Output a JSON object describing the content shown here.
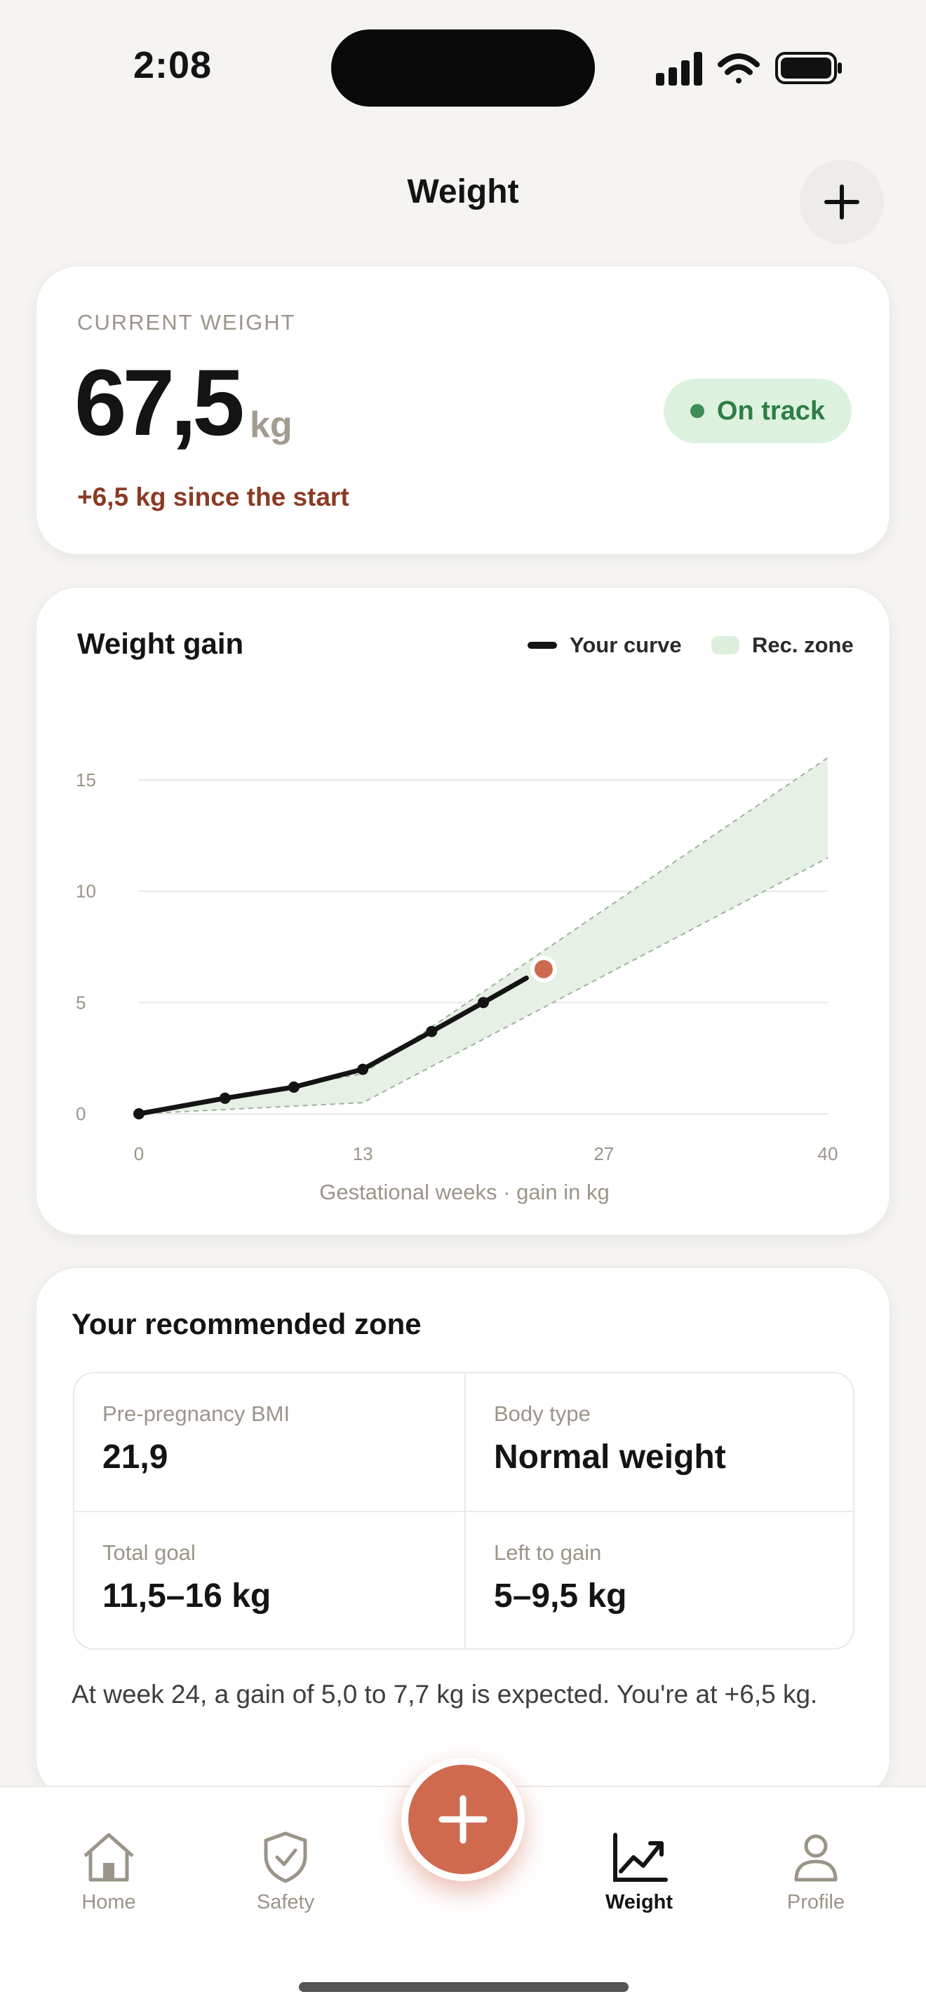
{
  "status": {
    "time": "2:08"
  },
  "header": {
    "title": "Weight"
  },
  "current": {
    "label": "CURRENT WEIGHT",
    "value": "67,5",
    "unit": "kg",
    "delta": "+6,5 kg since the start",
    "status": "On track"
  },
  "chart_data": {
    "type": "line",
    "title": "Weight gain",
    "xlabel": "Gestational weeks · gain in kg",
    "ylabel": "",
    "x_ticks": [
      "0",
      "13",
      "27",
      "40"
    ],
    "y_ticks": [
      "0",
      "5",
      "10",
      "15"
    ],
    "xlim": [
      0,
      40
    ],
    "ylim": [
      0,
      15
    ],
    "grid": true,
    "legend": [
      "Your curve",
      "Rec. zone"
    ],
    "legend_position": "top-right",
    "series": [
      {
        "name": "Your curve",
        "x": [
          0,
          5,
          9,
          13,
          17,
          20,
          22.5
        ],
        "y": [
          0,
          0.7,
          1.2,
          2.0,
          3.7,
          5.0,
          6.1
        ]
      }
    ],
    "current_point": {
      "x": 23.5,
      "y": 6.5
    },
    "zone": {
      "name": "Rec. zone",
      "upper": {
        "x": [
          0,
          13,
          40
        ],
        "y": [
          0,
          1.8,
          16
        ]
      },
      "lower": {
        "x": [
          0,
          13,
          40
        ],
        "y": [
          0,
          0.5,
          11.5
        ]
      }
    },
    "colors": {
      "line": "#141414",
      "zone_fill": "#e6f0e4",
      "zone_edge": "#9fb39e",
      "current": "#cf6a4f",
      "grid": "#e9e7e3"
    }
  },
  "zone": {
    "title": "Your recommended zone",
    "cells": [
      {
        "label": "Pre-pregnancy BMI",
        "value": "21,9"
      },
      {
        "label": "Body type",
        "value": "Normal weight"
      },
      {
        "label": "Total goal",
        "value": "11,5–16 kg"
      },
      {
        "label": "Left to gain",
        "value": "5–9,5 kg"
      }
    ],
    "note": "At week 24, a gain of 5,0 to 7,7 kg is expected. You're at +6,5 kg."
  },
  "tabs": [
    {
      "label": "Home",
      "icon": "home-icon",
      "active": false
    },
    {
      "label": "Safety",
      "icon": "shield-icon",
      "active": false
    },
    {
      "label": "Weight",
      "icon": "chart-icon",
      "active": true
    },
    {
      "label": "Profile",
      "icon": "person-icon",
      "active": false
    }
  ],
  "colors": {
    "accent": "#cf6a4f",
    "ok_bg": "#dcf2df",
    "ok_text": "#2f7d45",
    "delta": "#8a3b24"
  }
}
